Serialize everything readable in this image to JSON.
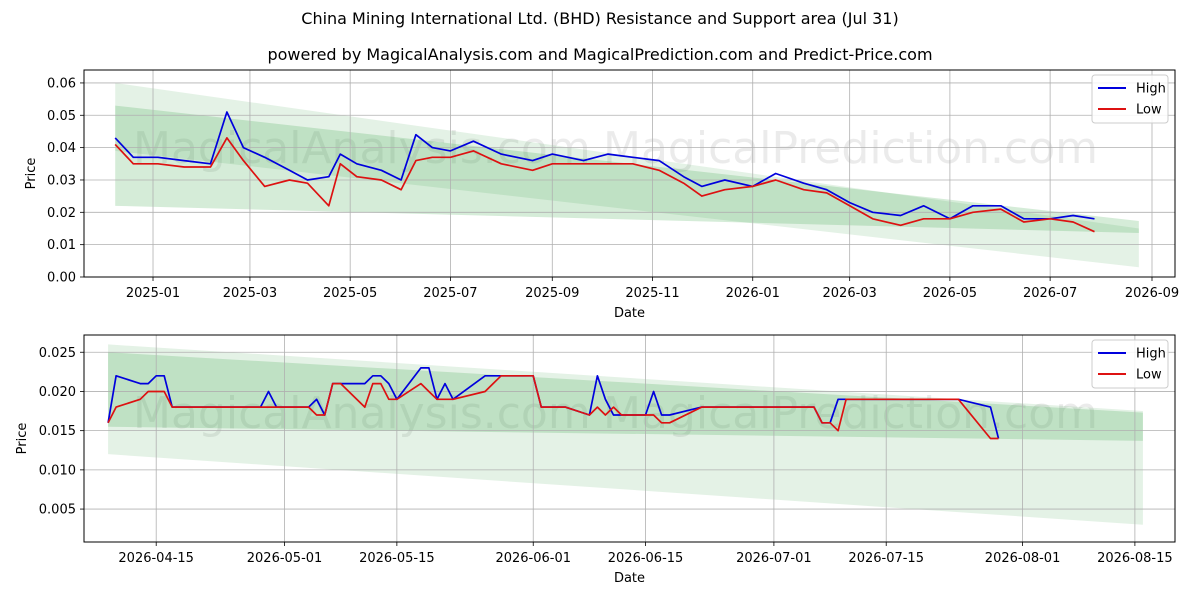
{
  "header": {
    "title": "China Mining International Ltd. (BHD) Resistance and Support area (Jul 31)",
    "subtitle": "powered by MagicalAnalysis.com and MagicalPrediction.com and Predict-Price.com"
  },
  "watermarks": [
    "MagicalAnalysis.com",
    "MagicalPrediction.com"
  ],
  "colors": {
    "high": "#0000dd",
    "low": "#dd1111",
    "band": "#2e9e3e"
  },
  "chart_data": [
    {
      "type": "line",
      "xlabel": "Date",
      "ylabel": "Price",
      "xlim": [
        "2024-11-20",
        "2026-09-15"
      ],
      "ylim": [
        0,
        0.064
      ],
      "x_ticks": [
        "2025-01",
        "2025-03",
        "2025-05",
        "2025-07",
        "2025-09",
        "2025-11",
        "2026-01",
        "2026-03",
        "2026-05",
        "2026-07",
        "2026-09"
      ],
      "y_ticks": [
        "0.00",
        "0.01",
        "0.02",
        "0.03",
        "0.04",
        "0.05",
        "0.06"
      ],
      "grid": true,
      "legend": "top-right",
      "bands": [
        {
          "x": [
            "2024-12-09",
            "2026-08-24"
          ],
          "upper": [
            0.053,
            0.0173
          ],
          "lower": [
            0.022,
            0.0136
          ]
        },
        {
          "x": [
            "2024-12-09",
            "2026-08-24"
          ],
          "upper": [
            0.06,
            0.015
          ],
          "lower": [
            0.039,
            0.003
          ]
        }
      ],
      "x": [
        "2024-12-09",
        "2024-12-20",
        "2025-01-04",
        "2025-01-20",
        "2025-02-05",
        "2025-02-15",
        "2025-02-25",
        "2025-03-10",
        "2025-03-25",
        "2025-04-05",
        "2025-04-18",
        "2025-04-25",
        "2025-05-05",
        "2025-05-20",
        "2025-06-01",
        "2025-06-10",
        "2025-06-20",
        "2025-07-01",
        "2025-07-15",
        "2025-08-01",
        "2025-08-20",
        "2025-09-01",
        "2025-09-20",
        "2025-10-05",
        "2025-10-20",
        "2025-11-05",
        "2025-11-20",
        "2025-12-01",
        "2025-12-15",
        "2026-01-01",
        "2026-01-15",
        "2026-02-01",
        "2026-02-15",
        "2026-03-01",
        "2026-03-15",
        "2026-04-01",
        "2026-04-15",
        "2026-05-01",
        "2026-05-15",
        "2026-06-01",
        "2026-06-15",
        "2026-07-01",
        "2026-07-15",
        "2026-07-28"
      ],
      "series": [
        {
          "name": "High",
          "values": [
            0.043,
            0.037,
            0.037,
            0.036,
            0.035,
            0.051,
            0.04,
            0.037,
            0.033,
            0.03,
            0.031,
            0.038,
            0.035,
            0.033,
            0.03,
            0.044,
            0.04,
            0.039,
            0.042,
            0.038,
            0.036,
            0.038,
            0.036,
            0.038,
            0.037,
            0.036,
            0.031,
            0.028,
            0.03,
            0.028,
            0.032,
            0.029,
            0.027,
            0.023,
            0.02,
            0.019,
            0.022,
            0.018,
            0.022,
            0.022,
            0.018,
            0.018,
            0.019,
            0.018
          ]
        },
        {
          "name": "Low",
          "values": [
            0.041,
            0.035,
            0.035,
            0.034,
            0.034,
            0.043,
            0.036,
            0.028,
            0.03,
            0.029,
            0.022,
            0.035,
            0.031,
            0.03,
            0.027,
            0.036,
            0.037,
            0.037,
            0.039,
            0.035,
            0.033,
            0.035,
            0.035,
            0.035,
            0.035,
            0.033,
            0.029,
            0.025,
            0.027,
            0.028,
            0.03,
            0.027,
            0.026,
            0.022,
            0.018,
            0.016,
            0.018,
            0.018,
            0.02,
            0.021,
            0.017,
            0.018,
            0.017,
            0.014
          ]
        }
      ]
    },
    {
      "type": "line",
      "xlabel": "Date",
      "ylabel": "Price",
      "xlim": [
        "2026-04-06",
        "2026-08-20"
      ],
      "ylim": [
        0.0008,
        0.0272
      ],
      "x_ticks": [
        "2026-04-15",
        "2026-05-01",
        "2026-05-15",
        "2026-06-01",
        "2026-06-15",
        "2026-07-01",
        "2026-07-15",
        "2026-08-01",
        "2026-08-15"
      ],
      "y_ticks": [
        "0.005",
        "0.010",
        "0.015",
        "0.020",
        "0.025"
      ],
      "grid": true,
      "legend": "top-right",
      "bands": [
        {
          "x": [
            "2026-04-09",
            "2026-08-16"
          ],
          "upper": [
            0.025,
            0.0173
          ],
          "lower": [
            0.0155,
            0.0137
          ]
        },
        {
          "x": [
            "2026-04-09",
            "2026-08-16"
          ],
          "upper": [
            0.026,
            0.0175
          ],
          "lower": [
            0.012,
            0.003
          ]
        }
      ],
      "x": [
        "2026-04-09",
        "2026-04-10",
        "2026-04-13",
        "2026-04-14",
        "2026-04-15",
        "2026-04-16",
        "2026-04-17",
        "2026-04-28",
        "2026-04-29",
        "2026-04-30",
        "2026-05-04",
        "2026-05-05",
        "2026-05-06",
        "2026-05-07",
        "2026-05-08",
        "2026-05-11",
        "2026-05-12",
        "2026-05-13",
        "2026-05-14",
        "2026-05-15",
        "2026-05-18",
        "2026-05-19",
        "2026-05-20",
        "2026-05-21",
        "2026-05-22",
        "2026-05-26",
        "2026-05-27",
        "2026-05-28",
        "2026-06-01",
        "2026-06-02",
        "2026-06-05",
        "2026-06-08",
        "2026-06-09",
        "2026-06-10",
        "2026-06-11",
        "2026-06-12",
        "2026-06-15",
        "2026-06-16",
        "2026-06-17",
        "2026-06-18",
        "2026-06-22",
        "2026-07-06",
        "2026-07-07",
        "2026-07-08",
        "2026-07-09",
        "2026-07-10",
        "2026-07-13",
        "2026-07-24",
        "2026-07-28",
        "2026-07-29"
      ],
      "series": [
        {
          "name": "High",
          "values": [
            0.016,
            0.022,
            0.021,
            0.021,
            0.022,
            0.022,
            0.018,
            0.018,
            0.02,
            0.018,
            0.018,
            0.019,
            0.017,
            0.021,
            0.021,
            0.021,
            0.022,
            0.022,
            0.021,
            0.019,
            0.023,
            0.023,
            0.019,
            0.021,
            0.019,
            0.022,
            0.022,
            0.022,
            0.022,
            0.018,
            0.018,
            0.017,
            0.022,
            0.019,
            0.017,
            0.017,
            0.017,
            0.02,
            0.017,
            0.017,
            0.018,
            0.018,
            0.016,
            0.016,
            0.019,
            0.019,
            0.019,
            0.019,
            0.018,
            0.014
          ]
        },
        {
          "name": "Low",
          "values": [
            0.016,
            0.018,
            0.019,
            0.02,
            0.02,
            0.02,
            0.018,
            0.018,
            0.018,
            0.018,
            0.018,
            0.017,
            0.017,
            0.021,
            0.021,
            0.018,
            0.021,
            0.021,
            0.019,
            0.019,
            0.021,
            0.02,
            0.019,
            0.019,
            0.019,
            0.02,
            0.021,
            0.022,
            0.022,
            0.018,
            0.018,
            0.017,
            0.018,
            0.017,
            0.018,
            0.017,
            0.017,
            0.017,
            0.016,
            0.016,
            0.018,
            0.018,
            0.016,
            0.016,
            0.015,
            0.019,
            0.019,
            0.019,
            0.014,
            0.014
          ]
        }
      ]
    }
  ]
}
